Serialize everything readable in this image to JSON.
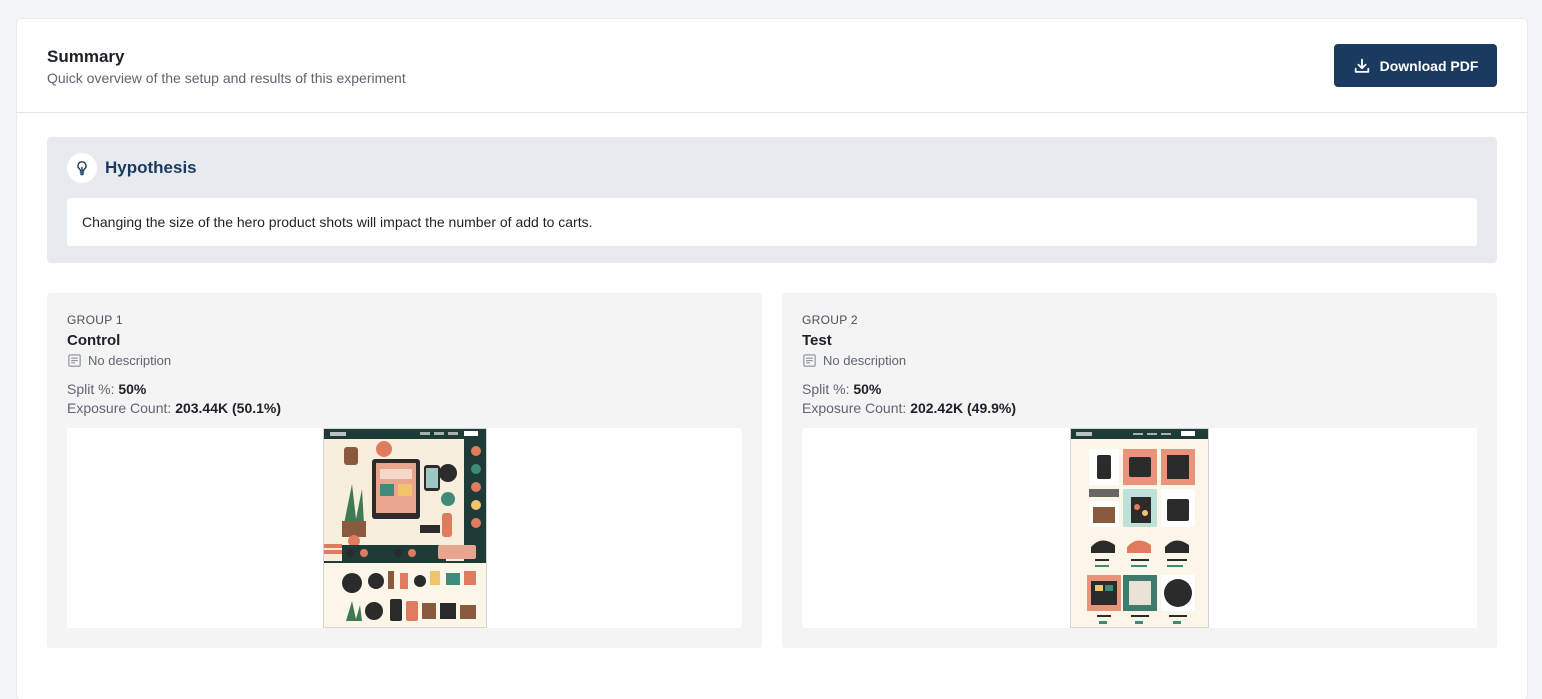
{
  "summary": {
    "title": "Summary",
    "subtitle": "Quick overview of the setup and results of this experiment",
    "download_label": "Download PDF"
  },
  "hypothesis": {
    "title": "Hypothesis",
    "text": "Changing the size of the hero product shots will impact the number of add to carts."
  },
  "groups": [
    {
      "label": "GROUP 1",
      "name": "Control",
      "description": "No description",
      "split_label": "Split %:",
      "split_value": "50%",
      "exposure_label": "Exposure Count:",
      "exposure_value": "203.44K (50.1%)"
    },
    {
      "label": "GROUP 2",
      "name": "Test",
      "description": "No description",
      "split_label": "Split %:",
      "split_value": "50%",
      "exposure_label": "Exposure Count:",
      "exposure_value": "202.42K (49.9%)"
    }
  ],
  "colors": {
    "primary": "#1b3a5f",
    "hypothesis_bg": "#e7ebef",
    "group_bg": "#f4f4f4",
    "page_bg": "#f4f5f7"
  },
  "icons": {
    "download": "download-icon",
    "hypothesis": "lightbulb-icon",
    "description": "note-icon"
  }
}
